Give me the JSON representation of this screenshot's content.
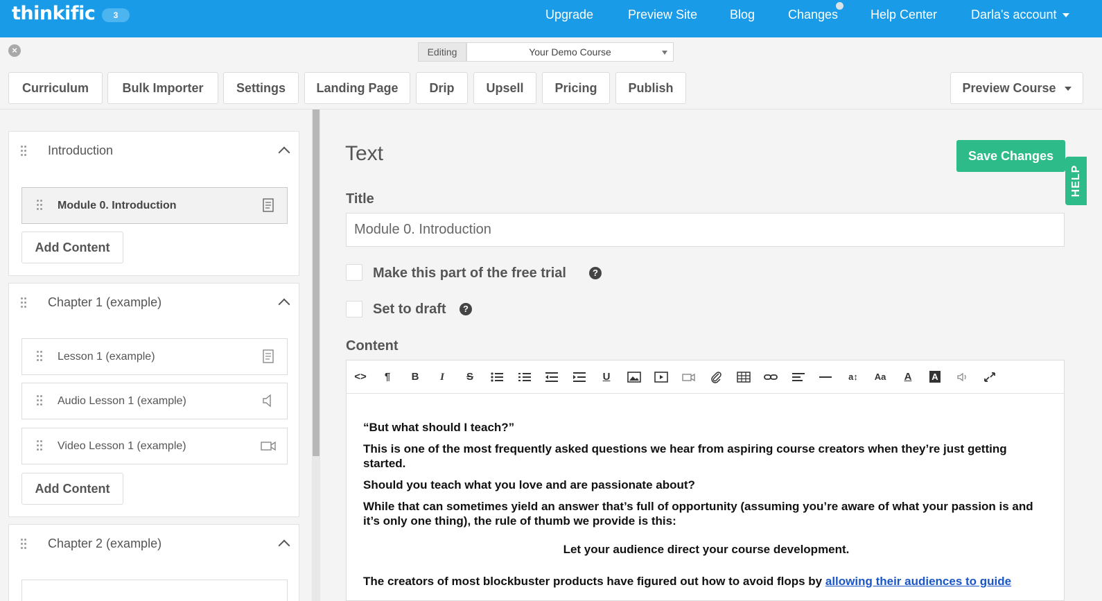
{
  "topbar": {
    "logo": "thinkific",
    "badge": "3",
    "nav": [
      "Upgrade",
      "Preview Site",
      "Blog",
      "Changes",
      "Help Center",
      "Darla's account"
    ]
  },
  "editing": {
    "label": "Editing",
    "course": "Your Demo Course"
  },
  "tabs": [
    "Curriculum",
    "Bulk Importer",
    "Settings",
    "Landing Page",
    "Drip",
    "Upsell",
    "Pricing",
    "Publish"
  ],
  "preview_course": "Preview Course",
  "sidebar": {
    "chapters": [
      {
        "title": "Introduction",
        "lessons": [
          {
            "label": "Module 0. Introduction",
            "icon": "text-lesson-icon"
          }
        ],
        "add_content": "Add Content"
      },
      {
        "title": "Chapter 1 (example)",
        "lessons": [
          {
            "label": "Lesson 1 (example)",
            "icon": "text-lesson-icon"
          },
          {
            "label": "Audio Lesson 1 (example)",
            "icon": "speaker-icon"
          },
          {
            "label": "Video Lesson 1 (example)",
            "icon": "video-camera-icon"
          }
        ],
        "add_content": "Add Content"
      },
      {
        "title": "Chapter 2 (example)",
        "lessons": [],
        "add_content": ""
      }
    ]
  },
  "main": {
    "heading": "Text",
    "save_label": "Save Changes",
    "help_label": "HELP",
    "title_label": "Title",
    "title_value": "Module 0. Introduction",
    "free_trial_label": "Make this part of the free trial",
    "draft_label": "Set to draft",
    "content_label": "Content"
  },
  "editor": {
    "toolbar_icons": [
      "code-view-icon",
      "paragraph-icon",
      "bold-icon",
      "italic-icon",
      "strikethrough-icon",
      "unordered-list-icon",
      "ordered-list-icon",
      "outdent-icon",
      "indent-icon",
      "underline-icon",
      "image-icon",
      "video-embed-icon",
      "video-camera-icon",
      "attach-file-icon",
      "table-icon",
      "link-icon",
      "align-icon",
      "horizontal-rule-icon",
      "font-size-icon",
      "font-family-icon",
      "font-color-icon",
      "background-color-icon",
      "audio-icon",
      "fullscreen-icon"
    ],
    "paragraphs": [
      "“But what should I teach?”",
      "This is one of the most frequently asked questions we hear from aspiring course creators when they’re just getting started.",
      "Should you teach what you love and are passionate about?",
      "While that can sometimes yield an answer that’s full of opportunity (assuming you’re aware of what your passion is and it’s only one thing), the rule of thumb we provide is this:"
    ],
    "centered": "Let your audience direct your course development.",
    "last_text": "The creators of most blockbuster products have figured out how to avoid flops by ",
    "last_link": "allowing their audiences to guide"
  },
  "colors": {
    "topbar": "#1a9be8",
    "save_button": "#2ebb8a",
    "link": "#1a56c6"
  }
}
